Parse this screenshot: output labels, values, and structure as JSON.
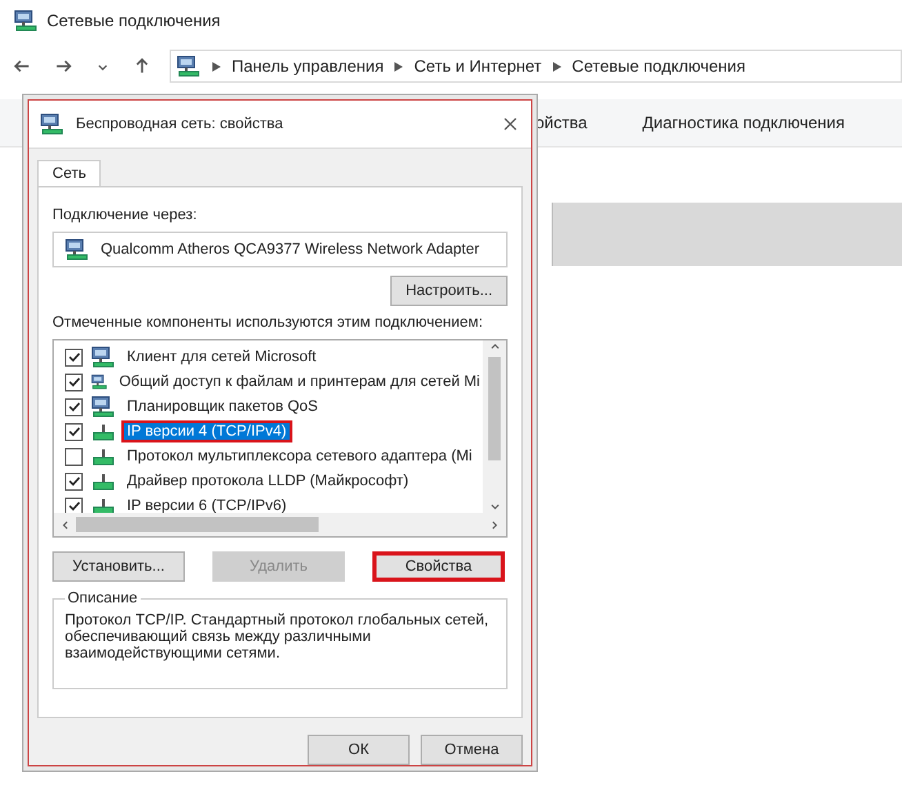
{
  "window": {
    "title": "Сетевые подключения"
  },
  "address_bar": {
    "path": [
      "Панель управления",
      "Сеть и Интернет",
      "Сетевые подключения"
    ]
  },
  "toolbar": {
    "items": [
      "ойства",
      "Диагностика подключения"
    ]
  },
  "dialog": {
    "title": "Беспроводная сеть: свойства",
    "tabs": [
      {
        "label": "Сеть",
        "selected": true
      }
    ],
    "connect_label": "Подключение через:",
    "adapter": "Qualcomm Atheros QCA9377 Wireless Network Adapter",
    "configure_button": "Настроить...",
    "components_label": "Отмеченные компоненты используются этим подключением:",
    "components": [
      {
        "name": "Клиент для сетей Microsoft",
        "checked": true,
        "selected": false,
        "kind": "client"
      },
      {
        "name": "Общий доступ к файлам и принтерам для сетей Mi",
        "checked": true,
        "selected": false,
        "kind": "client"
      },
      {
        "name": "Планировщик пакетов QoS",
        "checked": true,
        "selected": false,
        "kind": "client"
      },
      {
        "name": "IP версии 4 (TCP/IPv4)",
        "checked": true,
        "selected": true,
        "kind": "protocol"
      },
      {
        "name": "Протокол мультиплексора сетевого адаптера (Mi",
        "checked": false,
        "selected": false,
        "kind": "protocol"
      },
      {
        "name": "Драйвер протокола LLDP (Майкрософт)",
        "checked": true,
        "selected": false,
        "kind": "protocol"
      },
      {
        "name": "IP версии 6 (TCP/IPv6)",
        "checked": true,
        "selected": false,
        "kind": "protocol"
      }
    ],
    "buttons": [
      {
        "label": "Установить...",
        "disabled": false,
        "highlighted": false
      },
      {
        "label": "Удалить",
        "disabled": true,
        "highlighted": false
      },
      {
        "label": "Свойства",
        "disabled": false,
        "highlighted": true
      }
    ],
    "description_title": "Описание",
    "description": "Протокол TCP/IP. Стандартный протокол глобальных сетей, обеспечивающий связь между различными взаимодействующими сетями.",
    "footer_buttons": [
      "ОК",
      "Отмена"
    ]
  }
}
